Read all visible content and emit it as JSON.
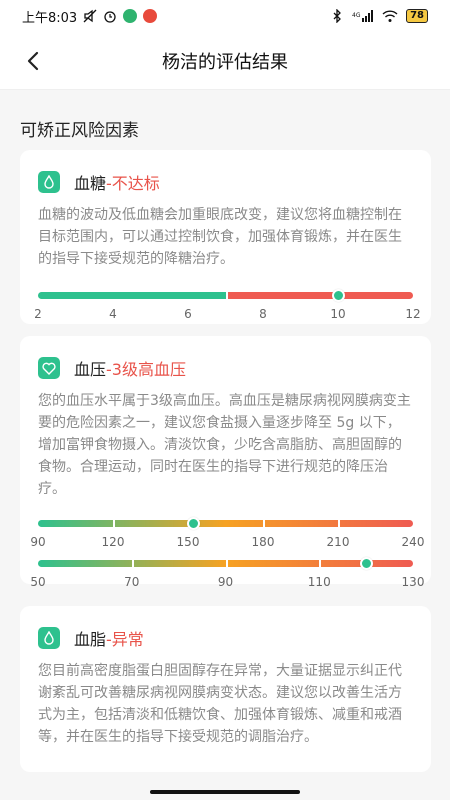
{
  "status_bar": {
    "time": "上午8:03",
    "signal_text": "4G",
    "battery": "78"
  },
  "header": {
    "title": "杨洁的评估结果",
    "back_icon": "chevron-left-icon"
  },
  "section_title": "可矫正风险因素",
  "cards": [
    {
      "icon": "drop-icon",
      "name": "血糖",
      "separator": "-",
      "status": "不达标",
      "text": "血糖的波动及低血糖会加重眼底改变，建议您将血糖控制在目标范围内，可以通过控制饮食，加强体育锻炼，并在医生的指导下接受规范的降糖治疗。"
    },
    {
      "icon": "heart-icon",
      "name": "血压",
      "separator": "-",
      "status": "3级高血压",
      "text": "您的血压水平属于3级高血压。高血压是糖尿病视网膜病变主要的危险因素之一，建议您食盐摄入量逐步降至 5g 以下，增加富钾食物摄入。清淡饮食，少吃含高脂肪、高胆固醇的食物。合理运动，同时在医生的指导下进行规范的降压治疗。"
    },
    {
      "icon": "drop-icon",
      "name": "血脂",
      "separator": "-",
      "status": "异常",
      "text": "您目前高密度脂蛋白胆固醇存在异常，大量证据显示纠正代谢紊乱可改善糖尿病视网膜病变状态。建议您以改善生活方式为主，包括清淡和低糖饮食、加强体育锻炼、减重和戒酒等，并在医生的指导下接受规范的调脂治疗。"
    }
  ],
  "scales": {
    "glucose": {
      "ticks": [
        "2",
        "4",
        "6",
        "8",
        "10",
        "12"
      ],
      "min": 2,
      "max": 12,
      "value": 10,
      "green_until": 7
    },
    "bp_systolic": {
      "ticks": [
        "90",
        "120",
        "150",
        "180",
        "210",
        "240"
      ],
      "min": 90,
      "max": 240,
      "value": 152
    },
    "bp_diastolic": {
      "ticks": [
        "50",
        "70",
        "90",
        "110",
        "130"
      ],
      "min": 50,
      "max": 130,
      "value": 125
    }
  },
  "colors": {
    "green": "#2ec18e",
    "red": "#ef5b52",
    "orange": "#f6a223",
    "status_red": "#e8534a"
  }
}
